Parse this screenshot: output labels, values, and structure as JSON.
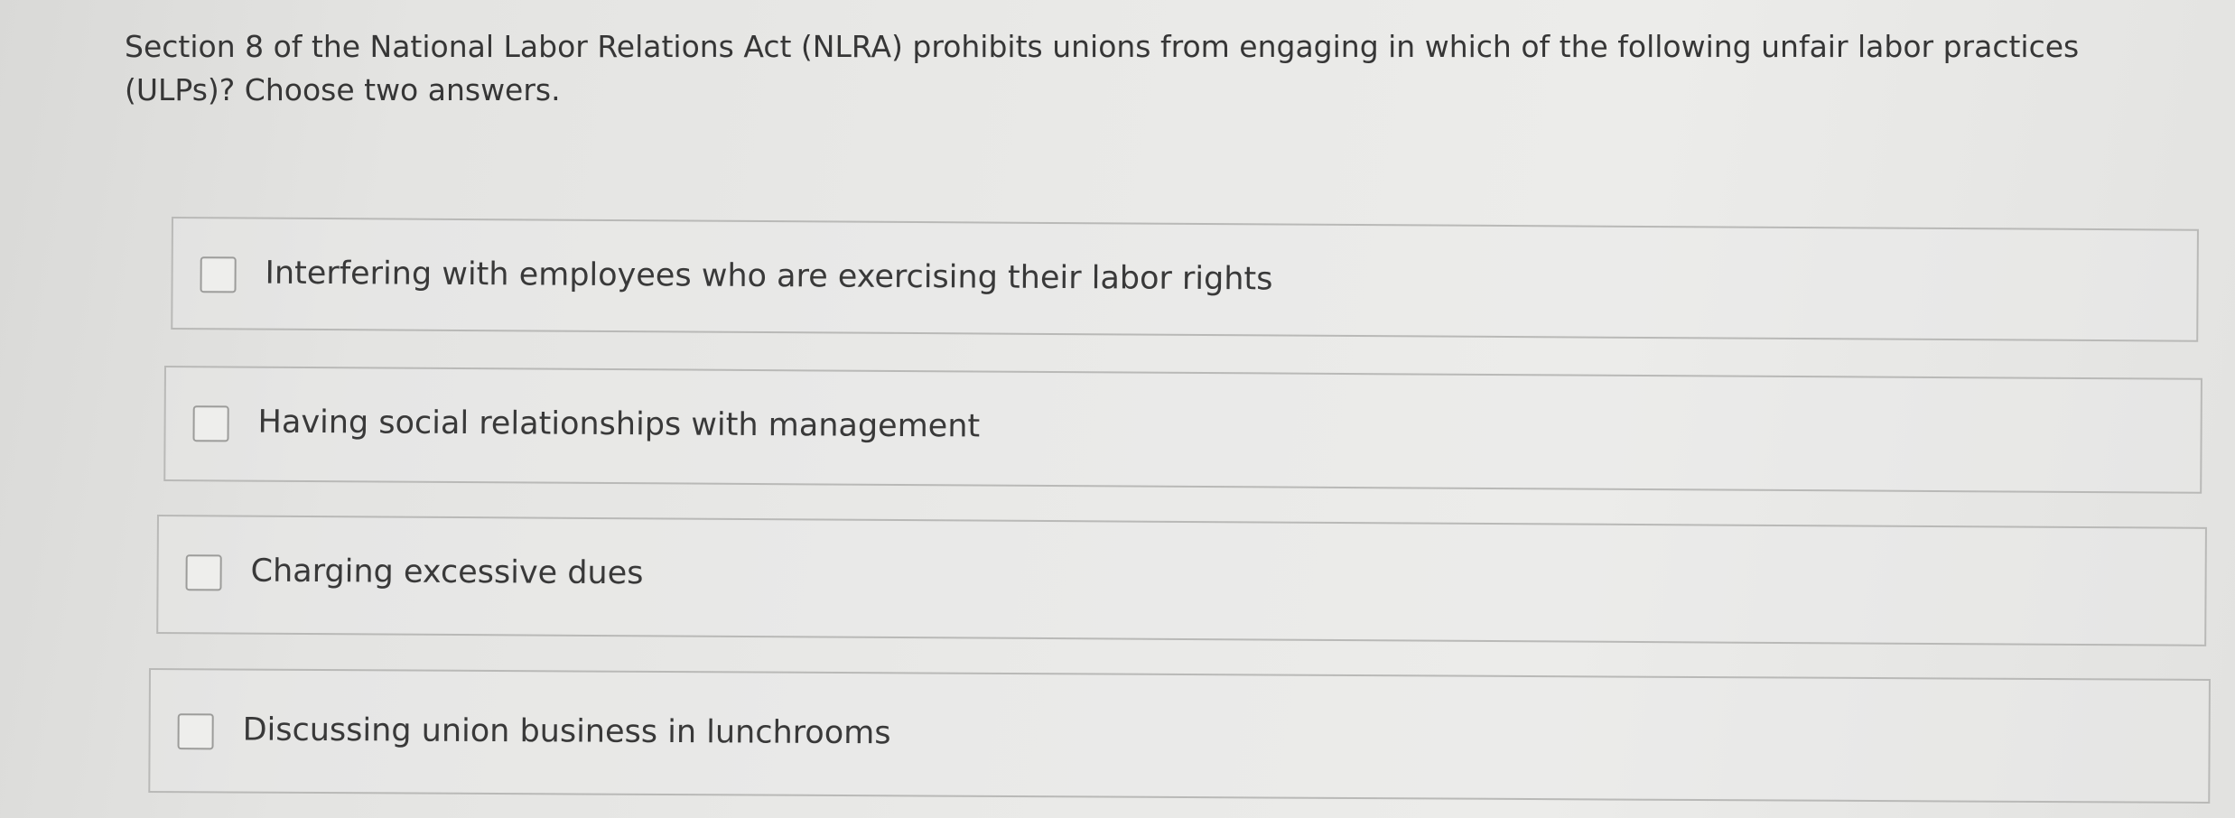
{
  "question": {
    "text": "Section 8 of the National Labor Relations Act (NLRA) prohibits unions from engaging in which of the following unfair labor practices (ULPs)? Choose two answers."
  },
  "options": [
    {
      "label": "Interfering with employees who are exercising their labor rights",
      "checked": false
    },
    {
      "label": "Having social relationships with management",
      "checked": false
    },
    {
      "label": "Charging excessive dues",
      "checked": false
    },
    {
      "label": "Discussing union business in lunchrooms",
      "checked": false
    }
  ],
  "colors": {
    "background": "#e6e6e4",
    "border": "#b9b9b7",
    "text": "#393939"
  }
}
